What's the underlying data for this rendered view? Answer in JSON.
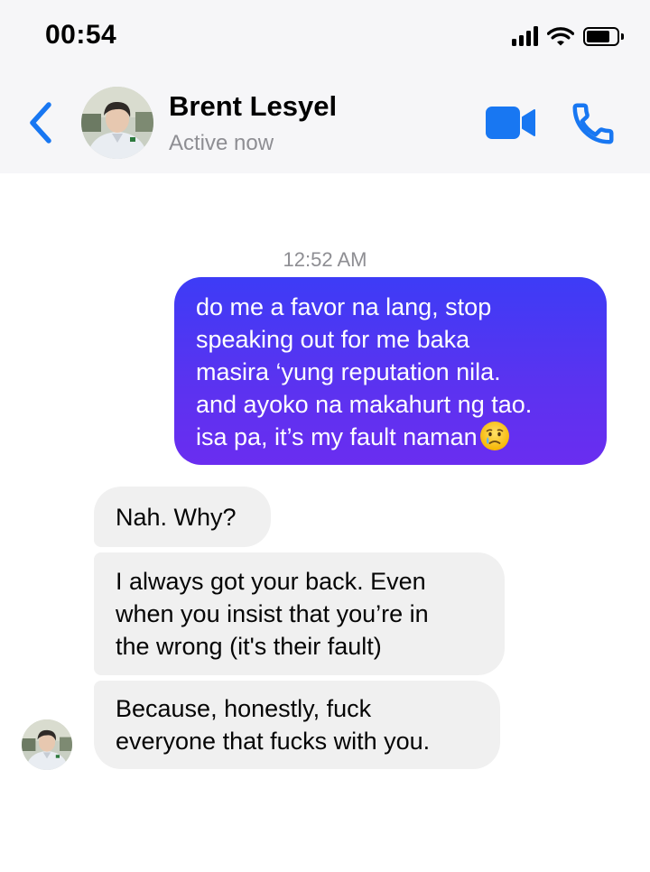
{
  "status_bar": {
    "time": "00:54",
    "icons": [
      "cellular-signal-icon",
      "wifi-icon",
      "battery-icon"
    ]
  },
  "header": {
    "back_icon": "chevron-left-icon",
    "contact_name": "Brent Lesyel",
    "contact_status": "Active now",
    "actions": [
      "video-camera-icon",
      "phone-icon"
    ]
  },
  "conversation": {
    "timestamp": "12:52 AM",
    "outgoing_message": {
      "text": "do me a favor na lang, stop\nspeaking out for me baka\nmasira ‘yung reputation nila.\nand ayoko na makahurt ng tao.\nisa pa, it’s my fault naman",
      "emoji": "crying-face-emoji"
    },
    "incoming_messages": [
      {
        "text": "Nah. Why?"
      },
      {
        "text": "I always got your back. Even\nwhen you insist that you’re in\nthe wrong (it's their fault)"
      },
      {
        "text": "Because, honestly, fuck\neveryone that fucks with you."
      }
    ]
  },
  "colors": {
    "accent": "#1877f2",
    "outgoing_gradient_start": "#3d3cf6",
    "outgoing_gradient_end": "#6a2df0",
    "incoming_bubble": "#f0f0f0",
    "header_background": "#f6f6f8",
    "secondary_text": "#8e8e93"
  }
}
